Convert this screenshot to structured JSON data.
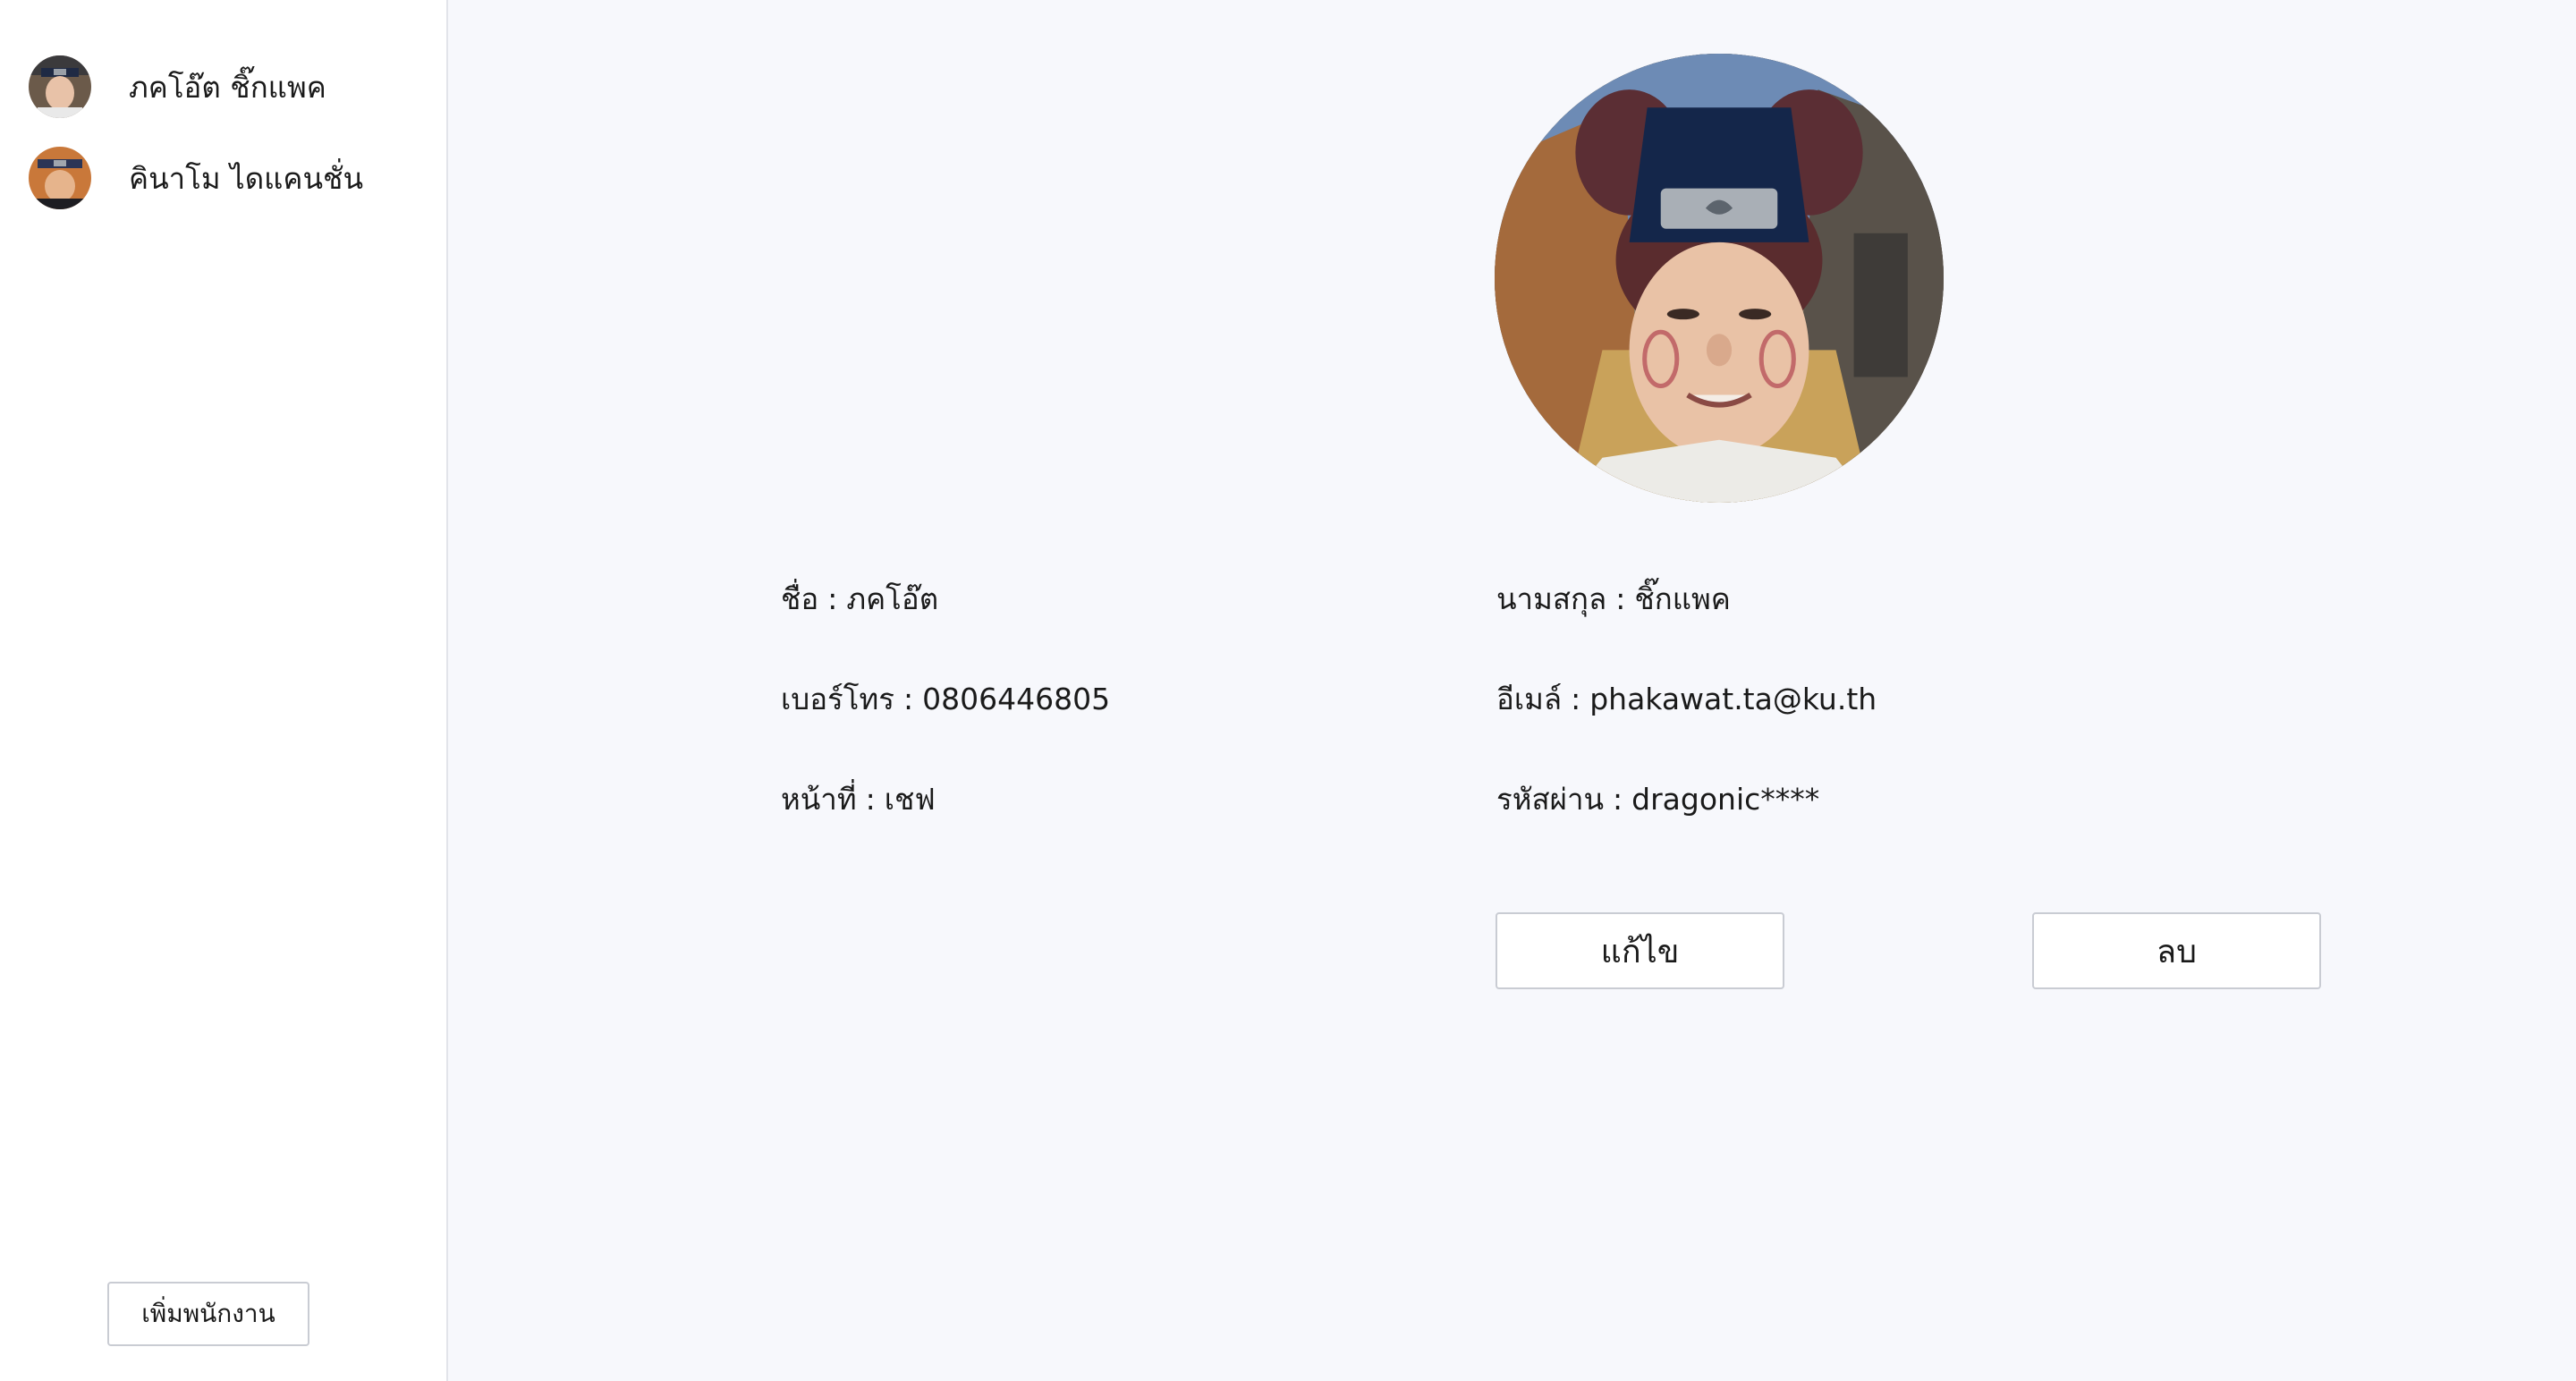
{
  "sidebar": {
    "employees": [
      {
        "name": "ภคโอ๊ต ชิ๊กแพค",
        "avatar_icon": "employee-avatar-photo"
      },
      {
        "name": "คินาโม ไดแคนชั่น",
        "avatar_icon": "employee-avatar-photo"
      }
    ],
    "add_button_label": "เพิ่มพนักงาน"
  },
  "profile": {
    "photo_icon": "profile-photo",
    "first_name": {
      "label": "ชื่อ",
      "value": "ภคโอ๊ต"
    },
    "last_name": {
      "label": "นามสกุล",
      "value": "ชิ๊กแพค"
    },
    "phone": {
      "label": "เบอร์โทร",
      "value": "0806446805"
    },
    "email": {
      "label": "อีเมล์",
      "value": "phakawat.ta@ku.th"
    },
    "role": {
      "label": "หน้าที่",
      "value": "เชฟ"
    },
    "password": {
      "label": "รหัสผ่าน",
      "value": "dragonic****"
    },
    "separator": ":"
  },
  "actions": {
    "edit_label": "แก้ไข",
    "delete_label": "ลบ"
  }
}
